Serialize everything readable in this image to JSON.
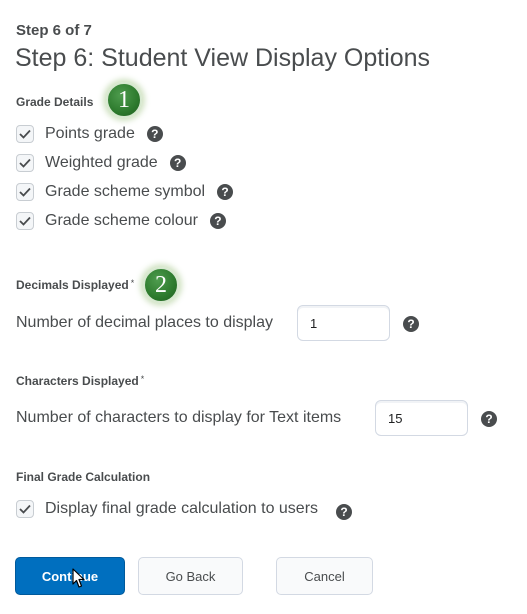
{
  "header": {
    "step_counter": "Step 6 of 7",
    "title": "Step 6: Student View Display Options"
  },
  "grade_details": {
    "label": "Grade Details",
    "badge": "1",
    "options": [
      {
        "label": "Points grade",
        "checked": true
      },
      {
        "label": "Weighted grade",
        "checked": true
      },
      {
        "label": "Grade scheme symbol",
        "checked": true
      },
      {
        "label": "Grade scheme colour",
        "checked": true
      }
    ]
  },
  "decimals": {
    "label": "Decimals Displayed",
    "required_mark": "*",
    "badge": "2",
    "field_label": "Number of decimal places to display",
    "value": "1"
  },
  "characters": {
    "label": "Characters Displayed",
    "required_mark": "*",
    "field_label": "Number of characters to display for Text items",
    "value": "15"
  },
  "final_grade": {
    "label": "Final Grade Calculation",
    "option_label": "Display final grade calculation to users",
    "checked": true
  },
  "buttons": {
    "continue": "Continue",
    "go_back": "Go Back",
    "cancel": "Cancel"
  },
  "icons": {
    "help": "question-circle-icon",
    "check": "checkmark-icon",
    "cursor": "mouse-pointer-icon",
    "help_glyph": "?"
  },
  "colors": {
    "primary": "#006fbf",
    "text": "#494c4e",
    "badge_green": "#2d7a2d"
  }
}
